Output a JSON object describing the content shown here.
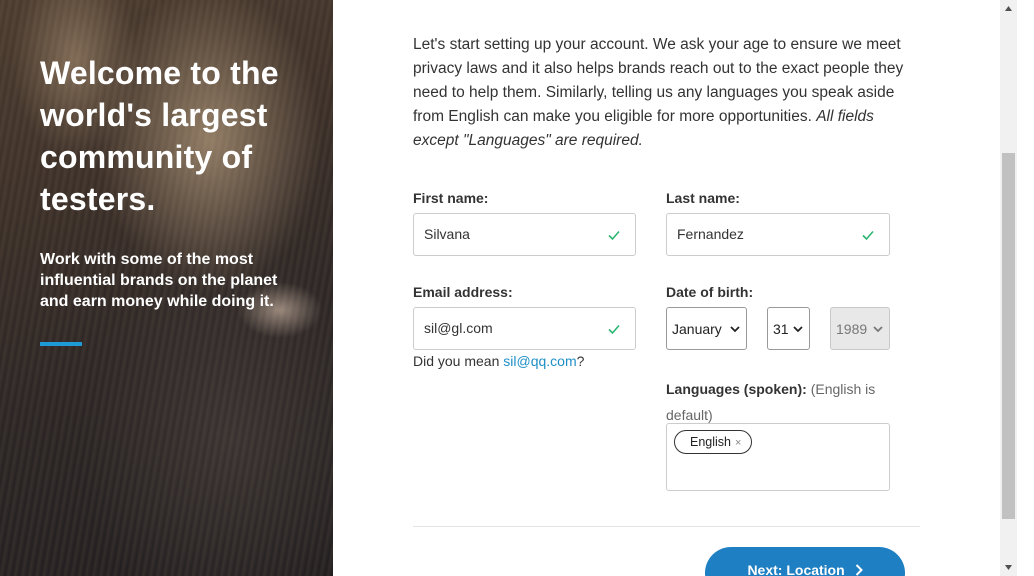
{
  "hero": {
    "title": "Welcome to the world's largest community of testers.",
    "subtitle": "Work with some of the most influential brands on the planet and earn money while doing it.",
    "accent_color": "#1e9ad6"
  },
  "intro": {
    "text": "Let's start setting up your account. We ask your age to ensure we meet privacy laws and it also helps brands reach out to the exact people they need to help them. Similarly, telling us any languages you speak aside from English can make you eligible for more opportunities.",
    "note": "All fields except \"Languages\" are required."
  },
  "form": {
    "first_name": {
      "label": "First name:",
      "value": "Silvana",
      "status_icon": "check-icon"
    },
    "last_name": {
      "label": "Last name:",
      "value": "Fernandez",
      "status_icon": "check-icon"
    },
    "email": {
      "label": "Email address:",
      "value": "sil@gl.com",
      "status_icon": "check-icon"
    },
    "email_suggestion": {
      "prefix": "Did you mean ",
      "link": "sil@qq.com",
      "suffix": "?"
    },
    "dob": {
      "label": "Date of birth:",
      "month": "January",
      "day": "31",
      "year": "1989"
    },
    "languages": {
      "label": "Languages (spoken):",
      "hint": "(English is default)",
      "tags": [
        {
          "label": "English",
          "remove": "×"
        }
      ]
    }
  },
  "actions": {
    "next_label": "Next: Location",
    "next_color": "#1e7fc2"
  },
  "colors": {
    "valid_check": "#2bb673",
    "link": "#1e8fc6"
  }
}
